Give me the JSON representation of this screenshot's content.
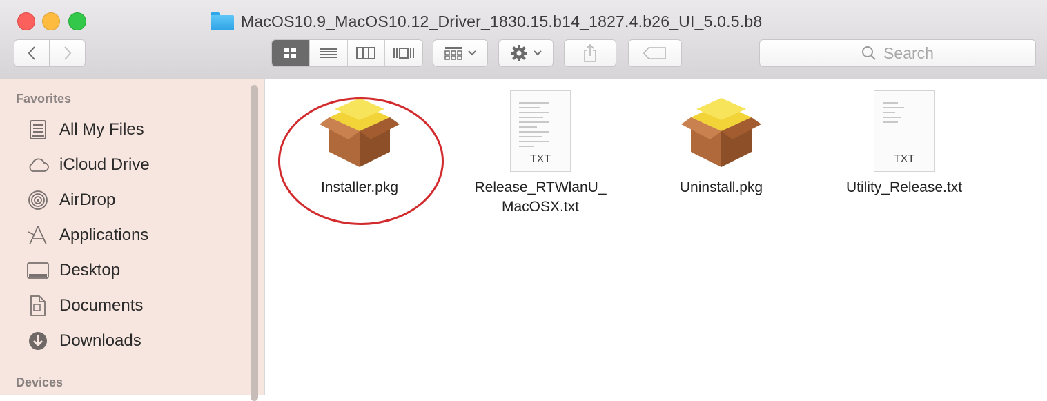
{
  "window": {
    "title": "MacOS10.9_MacOS10.12_Driver_1830.15.b14_1827.4.b26_UI_5.0.5.b8"
  },
  "toolbar": {
    "search_placeholder": "Search",
    "back_icon": "chevron-left-icon",
    "forward_icon": "chevron-right-icon"
  },
  "sidebar": {
    "favorites_title": "Favorites",
    "devices_title": "Devices",
    "items": [
      {
        "label": "All My Files",
        "icon": "all-my-files-icon"
      },
      {
        "label": "iCloud Drive",
        "icon": "cloud-icon"
      },
      {
        "label": "AirDrop",
        "icon": "airdrop-icon"
      },
      {
        "label": "Applications",
        "icon": "applications-icon"
      },
      {
        "label": "Desktop",
        "icon": "desktop-icon"
      },
      {
        "label": "Documents",
        "icon": "documents-icon"
      },
      {
        "label": "Downloads",
        "icon": "downloads-icon"
      }
    ]
  },
  "files": [
    {
      "name": "Installer.pkg",
      "type": "pkg"
    },
    {
      "name_line1": "Release_RTWlanU_",
      "name_line2": "MacOSX.txt",
      "type": "txt",
      "badge": "TXT"
    },
    {
      "name": "Uninstall.pkg",
      "type": "pkg"
    },
    {
      "name": "Utility_Release.txt",
      "type": "txt",
      "badge": "TXT"
    }
  ],
  "colors": {
    "highlight_circle": "#d22b2e",
    "sidebar_bg": "#f7e6df",
    "folder_blue": "#2ea3e6"
  }
}
